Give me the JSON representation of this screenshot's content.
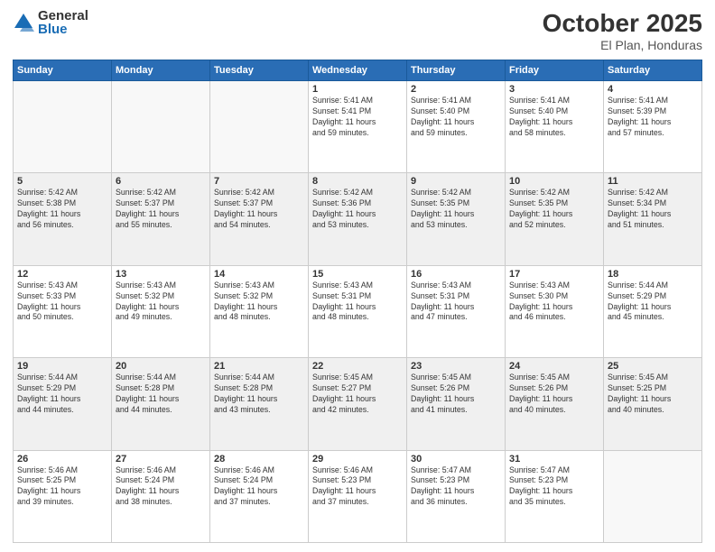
{
  "logo": {
    "general": "General",
    "blue": "Blue"
  },
  "header": {
    "month": "October 2025",
    "location": "El Plan, Honduras"
  },
  "days_of_week": [
    "Sunday",
    "Monday",
    "Tuesday",
    "Wednesday",
    "Thursday",
    "Friday",
    "Saturday"
  ],
  "weeks": [
    [
      {
        "day": "",
        "info": ""
      },
      {
        "day": "",
        "info": ""
      },
      {
        "day": "",
        "info": ""
      },
      {
        "day": "1",
        "info": "Sunrise: 5:41 AM\nSunset: 5:41 PM\nDaylight: 11 hours\nand 59 minutes."
      },
      {
        "day": "2",
        "info": "Sunrise: 5:41 AM\nSunset: 5:40 PM\nDaylight: 11 hours\nand 59 minutes."
      },
      {
        "day": "3",
        "info": "Sunrise: 5:41 AM\nSunset: 5:40 PM\nDaylight: 11 hours\nand 58 minutes."
      },
      {
        "day": "4",
        "info": "Sunrise: 5:41 AM\nSunset: 5:39 PM\nDaylight: 11 hours\nand 57 minutes."
      }
    ],
    [
      {
        "day": "5",
        "info": "Sunrise: 5:42 AM\nSunset: 5:38 PM\nDaylight: 11 hours\nand 56 minutes."
      },
      {
        "day": "6",
        "info": "Sunrise: 5:42 AM\nSunset: 5:37 PM\nDaylight: 11 hours\nand 55 minutes."
      },
      {
        "day": "7",
        "info": "Sunrise: 5:42 AM\nSunset: 5:37 PM\nDaylight: 11 hours\nand 54 minutes."
      },
      {
        "day": "8",
        "info": "Sunrise: 5:42 AM\nSunset: 5:36 PM\nDaylight: 11 hours\nand 53 minutes."
      },
      {
        "day": "9",
        "info": "Sunrise: 5:42 AM\nSunset: 5:35 PM\nDaylight: 11 hours\nand 53 minutes."
      },
      {
        "day": "10",
        "info": "Sunrise: 5:42 AM\nSunset: 5:35 PM\nDaylight: 11 hours\nand 52 minutes."
      },
      {
        "day": "11",
        "info": "Sunrise: 5:42 AM\nSunset: 5:34 PM\nDaylight: 11 hours\nand 51 minutes."
      }
    ],
    [
      {
        "day": "12",
        "info": "Sunrise: 5:43 AM\nSunset: 5:33 PM\nDaylight: 11 hours\nand 50 minutes."
      },
      {
        "day": "13",
        "info": "Sunrise: 5:43 AM\nSunset: 5:32 PM\nDaylight: 11 hours\nand 49 minutes."
      },
      {
        "day": "14",
        "info": "Sunrise: 5:43 AM\nSunset: 5:32 PM\nDaylight: 11 hours\nand 48 minutes."
      },
      {
        "day": "15",
        "info": "Sunrise: 5:43 AM\nSunset: 5:31 PM\nDaylight: 11 hours\nand 48 minutes."
      },
      {
        "day": "16",
        "info": "Sunrise: 5:43 AM\nSunset: 5:31 PM\nDaylight: 11 hours\nand 47 minutes."
      },
      {
        "day": "17",
        "info": "Sunrise: 5:43 AM\nSunset: 5:30 PM\nDaylight: 11 hours\nand 46 minutes."
      },
      {
        "day": "18",
        "info": "Sunrise: 5:44 AM\nSunset: 5:29 PM\nDaylight: 11 hours\nand 45 minutes."
      }
    ],
    [
      {
        "day": "19",
        "info": "Sunrise: 5:44 AM\nSunset: 5:29 PM\nDaylight: 11 hours\nand 44 minutes."
      },
      {
        "day": "20",
        "info": "Sunrise: 5:44 AM\nSunset: 5:28 PM\nDaylight: 11 hours\nand 44 minutes."
      },
      {
        "day": "21",
        "info": "Sunrise: 5:44 AM\nSunset: 5:28 PM\nDaylight: 11 hours\nand 43 minutes."
      },
      {
        "day": "22",
        "info": "Sunrise: 5:45 AM\nSunset: 5:27 PM\nDaylight: 11 hours\nand 42 minutes."
      },
      {
        "day": "23",
        "info": "Sunrise: 5:45 AM\nSunset: 5:26 PM\nDaylight: 11 hours\nand 41 minutes."
      },
      {
        "day": "24",
        "info": "Sunrise: 5:45 AM\nSunset: 5:26 PM\nDaylight: 11 hours\nand 40 minutes."
      },
      {
        "day": "25",
        "info": "Sunrise: 5:45 AM\nSunset: 5:25 PM\nDaylight: 11 hours\nand 40 minutes."
      }
    ],
    [
      {
        "day": "26",
        "info": "Sunrise: 5:46 AM\nSunset: 5:25 PM\nDaylight: 11 hours\nand 39 minutes."
      },
      {
        "day": "27",
        "info": "Sunrise: 5:46 AM\nSunset: 5:24 PM\nDaylight: 11 hours\nand 38 minutes."
      },
      {
        "day": "28",
        "info": "Sunrise: 5:46 AM\nSunset: 5:24 PM\nDaylight: 11 hours\nand 37 minutes."
      },
      {
        "day": "29",
        "info": "Sunrise: 5:46 AM\nSunset: 5:23 PM\nDaylight: 11 hours\nand 37 minutes."
      },
      {
        "day": "30",
        "info": "Sunrise: 5:47 AM\nSunset: 5:23 PM\nDaylight: 11 hours\nand 36 minutes."
      },
      {
        "day": "31",
        "info": "Sunrise: 5:47 AM\nSunset: 5:23 PM\nDaylight: 11 hours\nand 35 minutes."
      },
      {
        "day": "",
        "info": ""
      }
    ]
  ]
}
